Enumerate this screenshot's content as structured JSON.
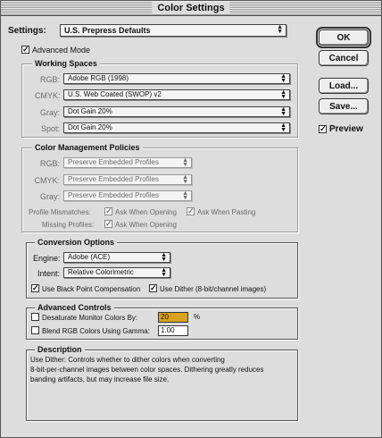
{
  "window": {
    "title": "Color Settings"
  },
  "settings": {
    "label": "Settings:",
    "value": "U.S. Prepress Defaults"
  },
  "advanced_mode": {
    "label": "Advanced Mode",
    "checked": true
  },
  "buttons": {
    "ok": "OK",
    "cancel": "Cancel",
    "load": "Load...",
    "save": "Save..."
  },
  "preview": {
    "label": "Preview",
    "checked": true
  },
  "working_spaces": {
    "title": "Working Spaces",
    "rows": [
      {
        "label": "RGB:",
        "value": "Adobe RGB (1998)"
      },
      {
        "label": "CMYK:",
        "value": "U.S. Web Coated (SWOP) v2"
      },
      {
        "label": "Gray:",
        "value": "Dot Gain 20%"
      },
      {
        "label": "Spot:",
        "value": "Dot Gain 20%"
      }
    ]
  },
  "color_management": {
    "title": "Color Management Policies",
    "rows": [
      {
        "label": "RGB:",
        "value": "Preserve Embedded Profiles"
      },
      {
        "label": "CMYK:",
        "value": "Preserve Embedded Profiles"
      },
      {
        "label": "Gray:",
        "value": "Preserve Embedded Profiles"
      }
    ],
    "mismatches_label": "Profile Mismatches:",
    "ask_when_opening": "Ask When Opening",
    "ask_when_pasting": "Ask When Pasting",
    "missing_label": "Missing Profiles:",
    "missing_ask_when_opening": "Ask When Opening"
  },
  "conversion": {
    "title": "Conversion Options",
    "engine_label": "Engine:",
    "engine_value": "Adobe (ACE)",
    "intent_label": "Intent:",
    "intent_value": "Relative Colorimetric",
    "black_point": "Use Black Point Compensation",
    "dither": "Use Dither (8-bit/channel images)"
  },
  "advanced_controls": {
    "title": "Advanced Controls",
    "desaturate_label": "Desaturate Monitor Colors By:",
    "desaturate_value": "20",
    "desaturate_unit": "%",
    "blend_label": "Blend RGB Colors Using Gamma:",
    "blend_value": "1.00"
  },
  "description": {
    "title": "Description",
    "lines": [
      "Use Dither: Controls whether to dither colors when converting",
      "8-bit-per-channel images between color spaces. Dithering greatly reduces",
      "banding artifacts, but may increase file size."
    ]
  },
  "colors": {
    "desaturate_field": "#d8a21c",
    "window_bg": "#dddddd"
  }
}
